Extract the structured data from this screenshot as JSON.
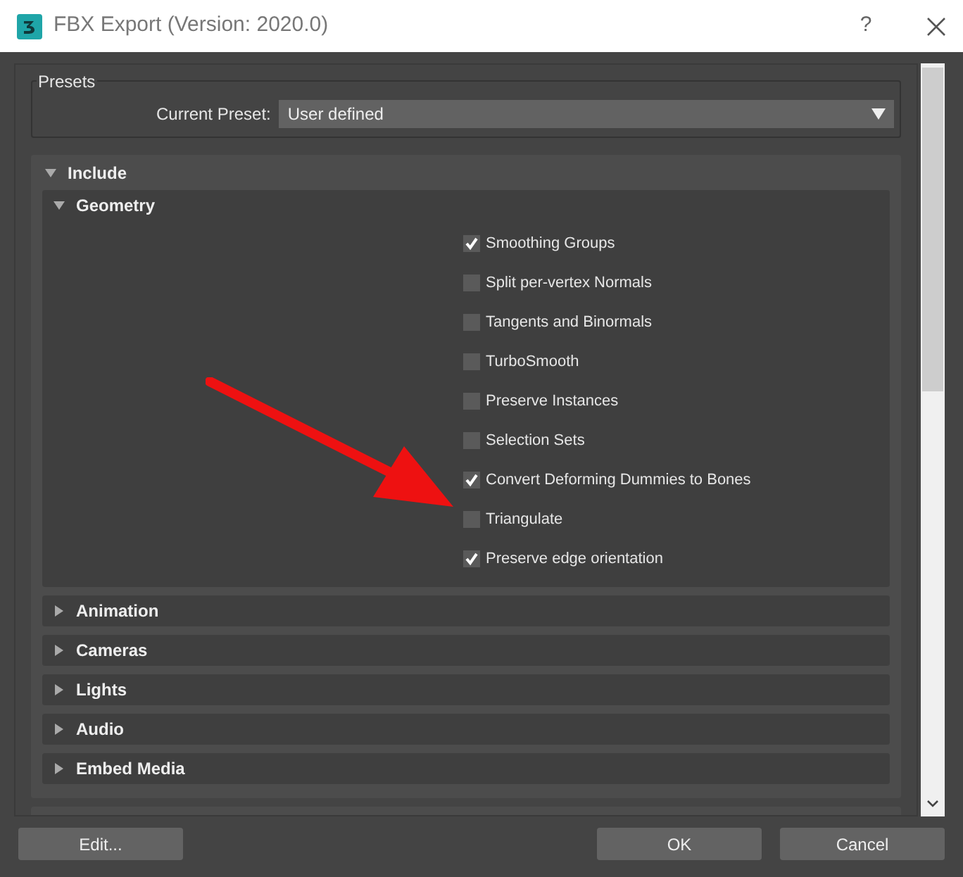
{
  "window": {
    "title": "FBX Export (Version: 2020.0)",
    "help": "?"
  },
  "presets": {
    "title": "Presets",
    "label": "Current Preset:",
    "value": "User defined"
  },
  "include": {
    "title": "Include",
    "expanded": true,
    "sections": [
      {
        "title": "Geometry",
        "expanded": true,
        "options": [
          {
            "label": "Smoothing Groups",
            "checked": true
          },
          {
            "label": "Split per-vertex Normals",
            "checked": false
          },
          {
            "label": "Tangents and Binormals",
            "checked": false
          },
          {
            "label": "TurboSmooth",
            "checked": false
          },
          {
            "label": "Preserve Instances",
            "checked": false
          },
          {
            "label": "Selection Sets",
            "checked": false
          },
          {
            "label": "Convert Deforming Dummies to Bones",
            "checked": true
          },
          {
            "label": "Triangulate",
            "checked": false
          },
          {
            "label": "Preserve edge orientation",
            "checked": true
          }
        ]
      },
      {
        "title": "Animation",
        "expanded": false
      },
      {
        "title": "Cameras",
        "expanded": false
      },
      {
        "title": "Lights",
        "expanded": false
      },
      {
        "title": "Audio",
        "expanded": false
      },
      {
        "title": "Embed Media",
        "expanded": false
      }
    ]
  },
  "buttons": {
    "edit": "Edit...",
    "ok": "OK",
    "cancel": "Cancel"
  }
}
